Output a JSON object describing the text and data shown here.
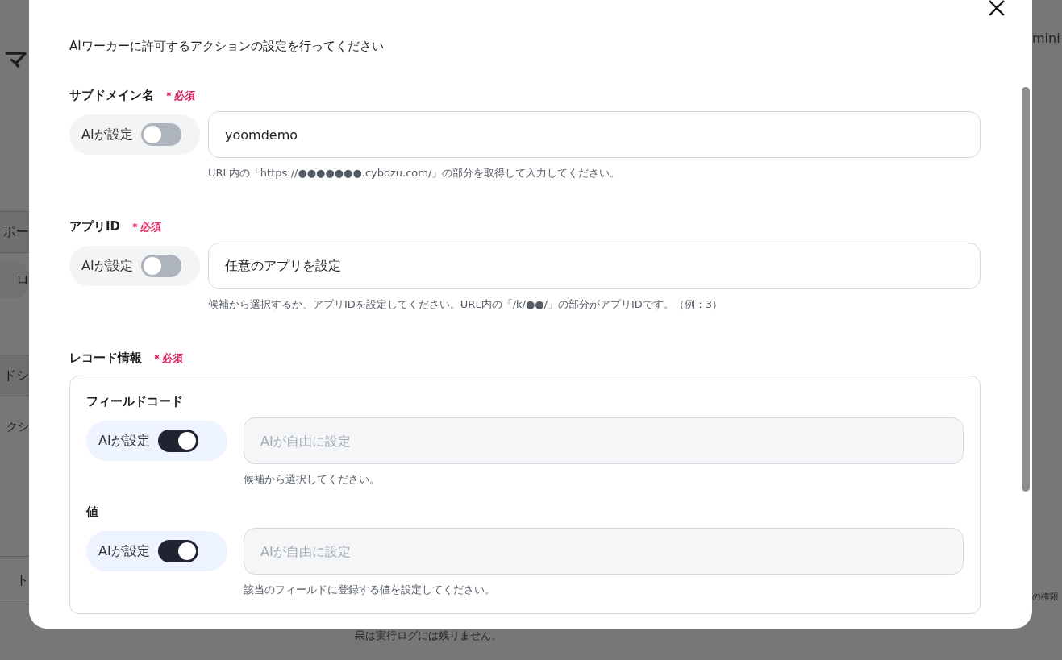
{
  "background": {
    "heading": "マ",
    "left_items": [
      {
        "kind": "tab",
        "text": "ポー"
      },
      {
        "kind": "pill",
        "text": "ロ"
      },
      {
        "kind": "tab",
        "text": "ドシ"
      },
      {
        "kind": "note",
        "text": "クシ"
      },
      {
        "kind": "row",
        "text": "ト"
      }
    ],
    "top_right": "mini",
    "side_note": "の権限",
    "footer_text": "果は実行ログには残りません。"
  },
  "dialog": {
    "description": "AIワーカーに許可するアクションの設定を行ってください",
    "fields": [
      {
        "kind": "simple",
        "label": "サブドメイン名",
        "required": "＊必須",
        "ai_toggle": {
          "label": "AIが設定",
          "on": false
        },
        "value": "yoomdemo",
        "hint": "URL内の「https://●●●●●●●.cybozu.com/」の部分を取得して入力してください。"
      },
      {
        "kind": "simple",
        "label": "アプリID",
        "required": "＊必須",
        "ai_toggle": {
          "label": "AIが設定",
          "on": false
        },
        "value": "任意のアプリを設定",
        "hint": "候補から選択するか、アプリIDを設定してください。URL内の「/k/●●/」の部分がアプリIDです。（例：3）"
      },
      {
        "kind": "group",
        "label": "レコード情報",
        "required": "＊必須",
        "children": [
          {
            "label": "フィールドコード",
            "ai_toggle": {
              "label": "AIが設定",
              "on": true
            },
            "placeholder": "AIが自由に設定",
            "hint": "候補から選択してください。"
          },
          {
            "label": "値",
            "ai_toggle": {
              "label": "AIが設定",
              "on": true
            },
            "placeholder": "AIが自由に設定",
            "hint": "該当のフィールドに登録する値を設定してください。"
          }
        ]
      }
    ]
  }
}
